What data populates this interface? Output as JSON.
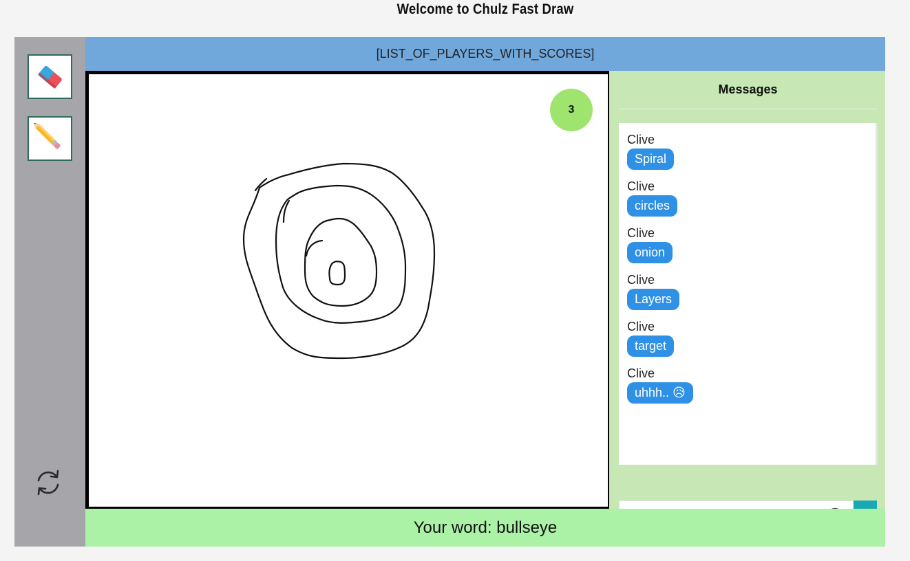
{
  "page": {
    "title": "Welcome to Chulz Fast Draw"
  },
  "toolbar": {
    "tools": [
      {
        "name": "eraser",
        "icon": "eraser-icon"
      },
      {
        "name": "pencil",
        "icon": "pencil-icon"
      }
    ],
    "refresh_icon": "refresh-icon"
  },
  "players": {
    "text": "[LIST_OF_PLAYERS_WITH_SCORES]"
  },
  "canvas": {
    "timer": "3"
  },
  "messages": {
    "title": "Messages",
    "items": [
      {
        "author": "Clive",
        "text": "Spiral"
      },
      {
        "author": "Clive",
        "text": "circles"
      },
      {
        "author": "Clive",
        "text": "onion"
      },
      {
        "author": "Clive",
        "text": "Layers"
      },
      {
        "author": "Clive",
        "text": "target"
      },
      {
        "author": "Clive",
        "text": "uhhh.. 😥"
      }
    ],
    "input": {
      "value": "",
      "emoji_icon": "smiley-icon",
      "send_icon": "return-arrow-icon",
      "send_label": "↲"
    }
  },
  "word": {
    "text": "Your word: bullseye"
  },
  "colors": {
    "toolbar_bg": "#a6a6aa",
    "players_bar_bg": "#71a8dc",
    "messages_bg": "#c7e8b5",
    "bubble_bg": "#2f91e6",
    "word_bar_bg": "#abf1a6",
    "timer_bg": "#9ee46e",
    "send_bg": "#1aa9b4"
  }
}
